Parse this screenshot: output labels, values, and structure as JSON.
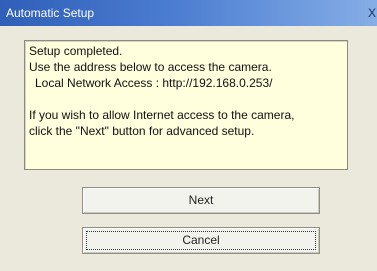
{
  "window": {
    "title": "Automatic Setup",
    "close_glyph": "X",
    "close_icon": "close-icon"
  },
  "message": {
    "lines": [
      "Setup completed.",
      "Use the address below to access the camera.",
      "Local Network Access : http://192.168.0.253/",
      "If you wish to allow Internet access to the camera,",
      "click the \"Next\" button for advanced setup."
    ],
    "background": "#ffffdd"
  },
  "buttons": {
    "next_label": "Next",
    "cancel_label": "Cancel"
  },
  "colors": {
    "titlebar_start": "#2f5fb8",
    "titlebar_end": "#86aee6",
    "dialog_face": "#ebe9dc"
  }
}
